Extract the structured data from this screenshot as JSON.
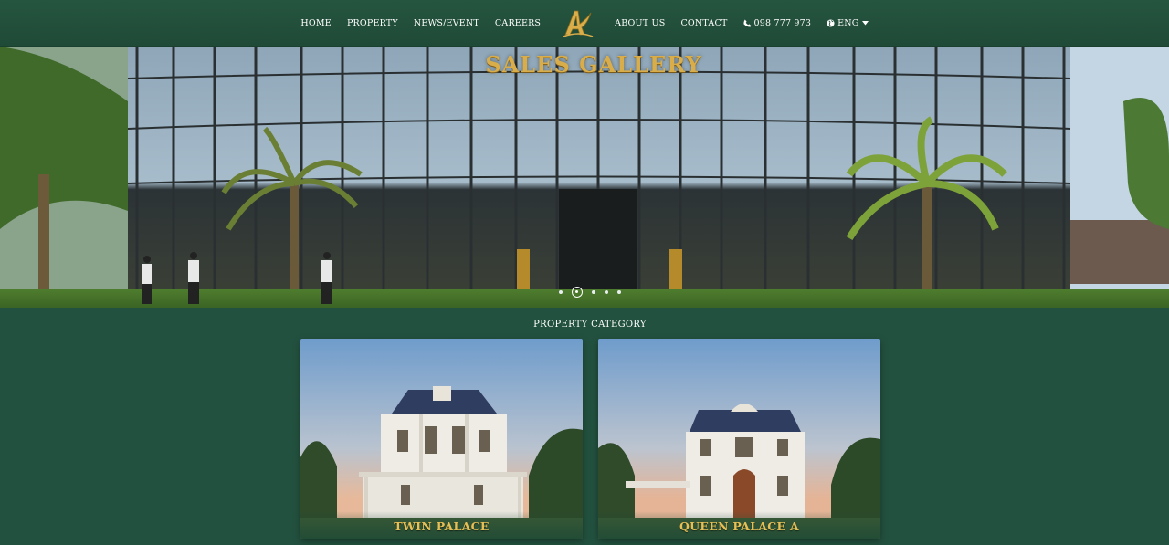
{
  "nav": {
    "home": "HOME",
    "property": "PROPERTY",
    "news": "NEWS/EVENT",
    "careers": "CAREERS",
    "about": "ABOUT US",
    "contact": "CONTACT",
    "phone": "098 777 973",
    "language": "ENG",
    "phone_icon": "phone-icon",
    "globe_icon": "globe-icon",
    "caret_icon": "caret-down-icon"
  },
  "hero": {
    "sign": "SALES GALLERY",
    "slide_count": 5,
    "active_slide": 2
  },
  "category": {
    "title": "PROPERTY CATEGORY",
    "items": [
      {
        "label": "TWIN PALACE"
      },
      {
        "label": "QUEEN PALACE A"
      }
    ]
  },
  "colors": {
    "background": "#23513f",
    "gold": "#e7bf55"
  }
}
